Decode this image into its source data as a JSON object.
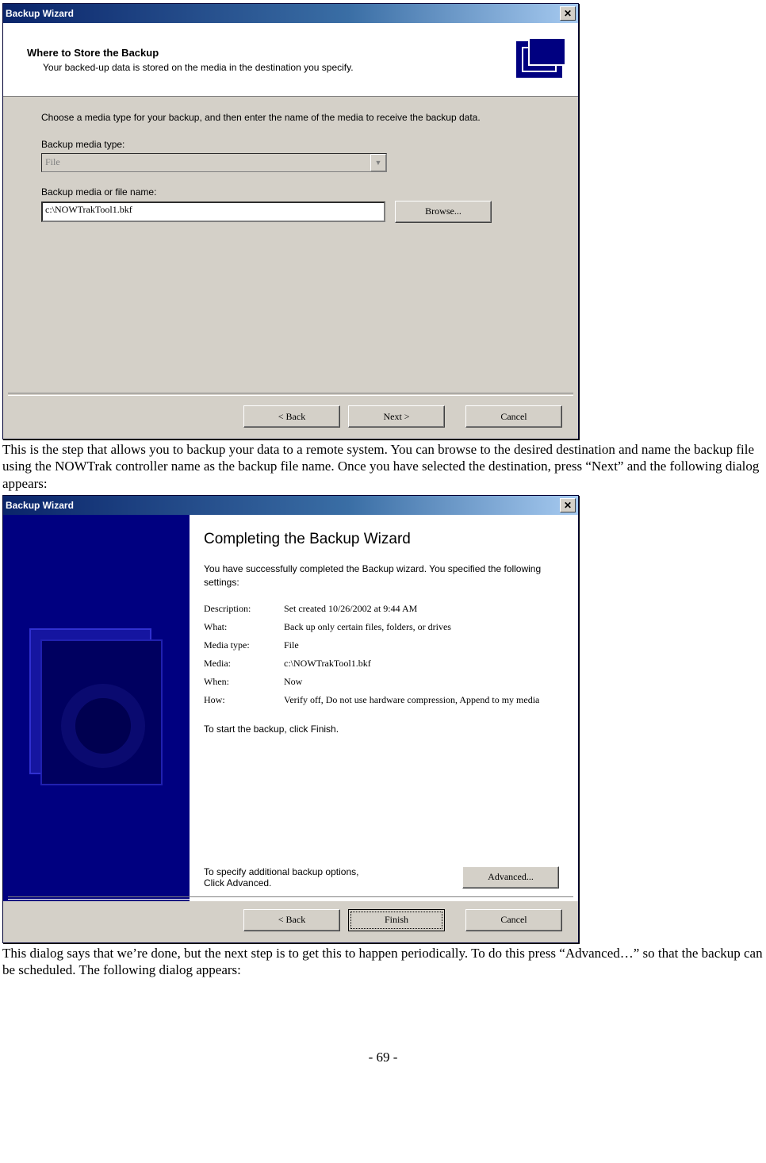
{
  "dialog1": {
    "title": "Backup Wizard",
    "close": "✕",
    "header": {
      "title": "Where to Store the Backup",
      "subtitle": "Your backed-up data is stored on the media in the destination you specify."
    },
    "intro": "Choose a media type for your backup, and then enter the name of the media to receive the backup data.",
    "media_type_label": "Backup media type:",
    "media_type_value": "File",
    "file_label": "Backup media or file name:",
    "file_value": "c:\\NOWTrakTool1.bkf",
    "browse": "Browse...",
    "back": "< Back",
    "next": "Next >",
    "cancel": "Cancel"
  },
  "para1": "This is the step that allows you to backup your data to a remote system.  You can browse to the desired destination and name the backup file using the NOWTrak controller name as the backup file name.  Once you have selected the destination, press “Next” and the following dialog appears:",
  "dialog2": {
    "title": "Backup Wizard",
    "close": "✕",
    "big_title": "Completing the Backup Wizard",
    "intro": "You have successfully completed the Backup wizard. You specified the following settings:",
    "rows": {
      "r0k": "Description:",
      "r0v": "Set created 10/26/2002 at 9:44 AM",
      "r1k": "What:",
      "r1v": "Back up only certain files, folders, or drives",
      "r2k": "Media type:",
      "r2v": "File",
      "r3k": "Media:",
      "r3v": "c:\\NOWTrakTool1.bkf",
      "r4k": "When:",
      "r4v": "Now",
      "r5k": "How:",
      "r5v": "Verify off, Do not use hardware compression, Append to my media"
    },
    "start": "To start the backup, click Finish.",
    "adv_text": "To specify additional backup options,\nClick Advanced.",
    "advanced": "Advanced...",
    "back": "< Back",
    "finish": "Finish",
    "cancel": "Cancel"
  },
  "para2": "This dialog says that we’re done, but the next step is to get this to happen periodically.  To do this press “Advanced…” so that the backup can be scheduled.  The following dialog appears:",
  "pagenum": "- 69 -"
}
